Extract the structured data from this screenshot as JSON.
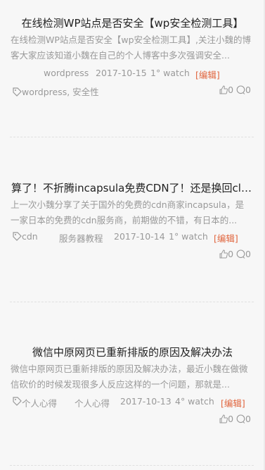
{
  "posts": [
    {
      "title": "在线检测WP站点是否安全【wp安全检测工具】",
      "excerpt": "在线检测WP站点是否安全【wp安全检测工具】,关注小魏的博客大家应该知道小魏在自己的个人博客中多次强调安全...",
      "category": "wordpress",
      "date": "2017-10-15",
      "watch": "1° watch",
      "edit": "[编辑]",
      "tags": "wordpress, 安全性",
      "likes": "0",
      "comments": "0"
    },
    {
      "title": "算了！不折腾incapsula免费CDN了！还是换回clo...",
      "excerpt": "上一次小魏分享了关于国外的免费的cdn商家incapsula，是一家日本的免费的cdn服务商，前期做的不错，有日本的...",
      "tags": "cdn",
      "category": "服务器教程",
      "date": "2017-10-14",
      "watch": "1° watch",
      "edit": "[编辑]",
      "likes": "0",
      "comments": "0"
    },
    {
      "title": "微信中原网页已重新排版的原因及解决办法",
      "excerpt": "微信中原网页已重新排版的原因及解决办法，最近小魏在做微信砍价的时候发现很多人反应这样的一个问题，那就是...",
      "tags": "个人心得",
      "category": "个人心得",
      "date": "2017-10-13",
      "watch": "4° watch",
      "edit": "[编辑]",
      "likes": "0",
      "comments": "0"
    }
  ],
  "icons": {
    "tag": "tag-icon",
    "like": "thumbs-up-icon",
    "comment": "comment-icon"
  },
  "colors": {
    "edit": "#e0643c",
    "muted": "#999999",
    "title": "#222222",
    "background": "#f7f7f7"
  }
}
